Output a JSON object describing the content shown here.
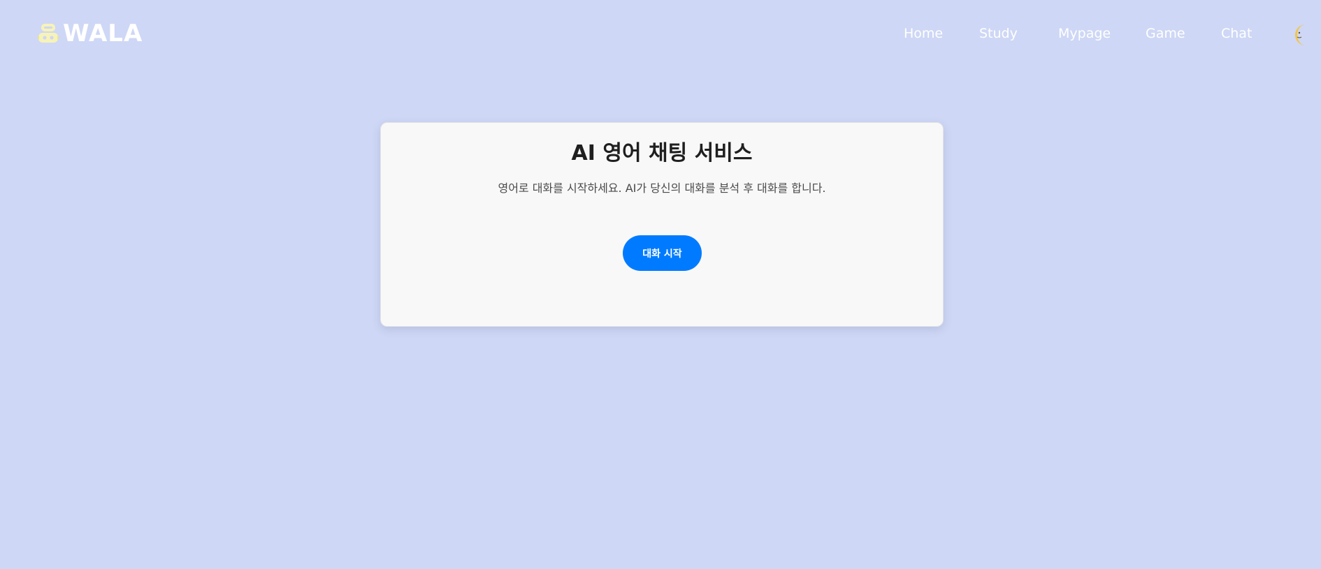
{
  "header": {
    "logo_text": "WALA",
    "logo_icon": "robot-icon",
    "nav": [
      "Home",
      "Study",
      "Mypage",
      "Game",
      "Chat"
    ],
    "theme_toggle_icon": "moon-icon"
  },
  "main": {
    "title": "AI 영어 채팅 서비스",
    "subtitle": "영어로 대화를 시작하세요. AI가 당신의 대화를 분석 후 대화를 합니다.",
    "start_button_label": "대화 시작"
  },
  "colors": {
    "background": "#ced7f5",
    "card": "#f8f8f8",
    "button": "#007bff",
    "moon": "#f4c542",
    "logo_icon": "#f7f3b8"
  }
}
